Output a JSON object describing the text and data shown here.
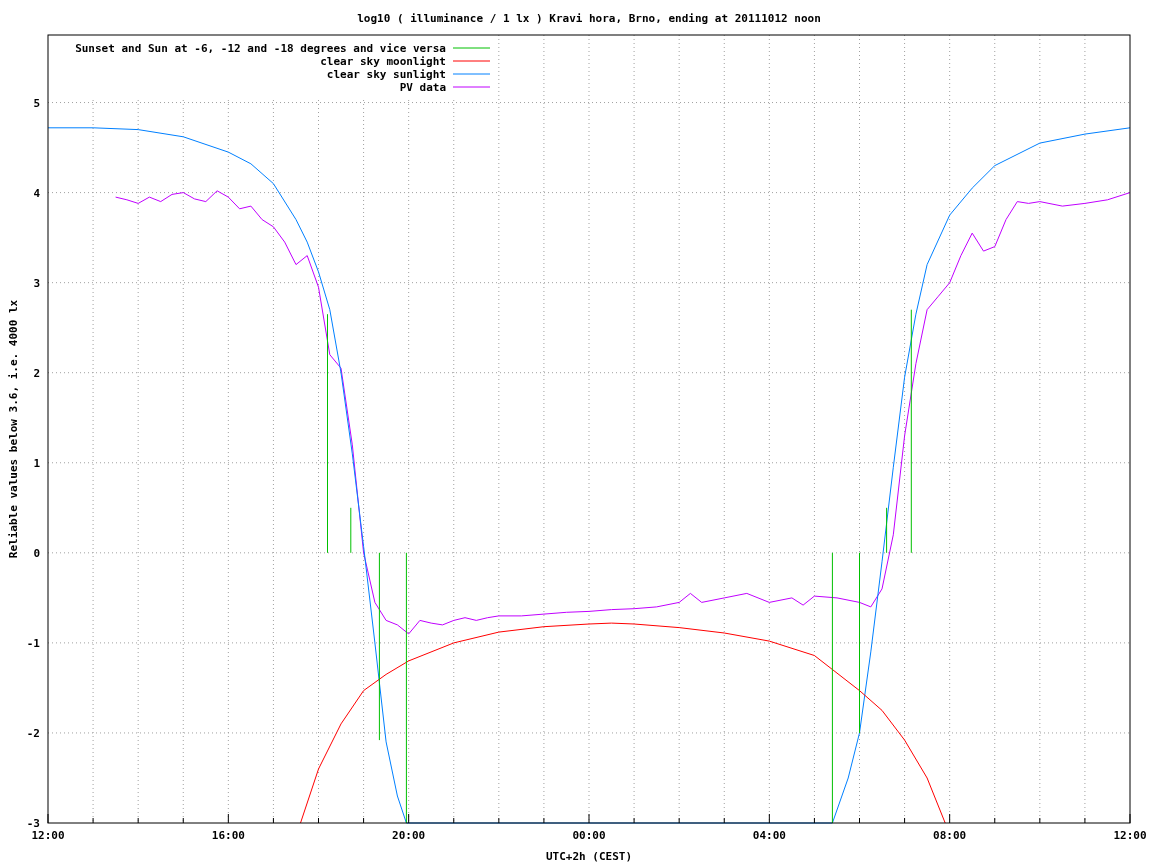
{
  "chart_data": {
    "type": "line",
    "title": "log10 ( illuminance / 1 lx ) Kravi hora, Brno, ending at 20111012 noon",
    "xlabel": "UTC+2h (CEST)",
    "ylabel": "Reliable values below 3.6, i.e. 4000 lx",
    "grid": true,
    "legend": true,
    "xlim": [
      "2011-10-11T12:00",
      "2011-10-12T12:00"
    ],
    "ylim": [
      -3,
      5.75
    ],
    "xticks": [
      {
        "value": "2011-10-11T12:00",
        "label": "12:00"
      },
      {
        "value": "2011-10-11T16:00",
        "label": "16:00"
      },
      {
        "value": "2011-10-11T20:00",
        "label": "20:00"
      },
      {
        "value": "2011-10-12T00:00",
        "label": "00:00"
      },
      {
        "value": "2011-10-12T04:00",
        "label": "04:00"
      },
      {
        "value": "2011-10-12T08:00",
        "label": "08:00"
      },
      {
        "value": "2011-10-12T12:00",
        "label": "12:00"
      }
    ],
    "yticks": [
      -3,
      -2,
      -1,
      0,
      1,
      2,
      3,
      4,
      5
    ],
    "series": [
      {
        "name": "Sunset and Sun at -6, -12 and -18 degrees and vice versa",
        "color": "#00c000",
        "x": [
          "2011-10-11T18:12",
          "2011-10-11T18:12",
          null,
          "2011-10-11T18:43",
          "2011-10-11T18:43",
          null,
          "2011-10-11T19:21",
          "2011-10-11T19:21",
          null,
          "2011-10-11T19:57",
          "2011-10-11T19:57",
          null,
          "2011-10-12T05:24",
          "2011-10-12T05:24",
          null,
          "2011-10-12T06:00",
          "2011-10-12T06:00",
          null,
          "2011-10-12T06:36",
          "2011-10-12T06:36",
          null,
          "2011-10-12T07:09",
          "2011-10-12T07:09"
        ],
        "values": [
          0,
          2.65,
          null,
          0,
          0.5,
          null,
          0,
          -2.08,
          null,
          0,
          -3,
          null,
          0,
          -3,
          null,
          0,
          -2.0,
          null,
          0,
          0.5,
          null,
          0,
          2.7
        ]
      },
      {
        "name": "clear sky moonlight",
        "color": "#ff0000",
        "x": [
          "2011-10-11T17:36",
          "2011-10-11T18:00",
          "2011-10-11T18:30",
          "2011-10-11T19:00",
          "2011-10-11T19:30",
          "2011-10-11T20:00",
          "2011-10-11T21:00",
          "2011-10-11T22:00",
          "2011-10-11T23:00",
          "2011-10-12T00:00",
          "2011-10-12T00:30",
          "2011-10-12T01:00",
          "2011-10-12T02:00",
          "2011-10-12T03:00",
          "2011-10-12T04:00",
          "2011-10-12T05:00",
          "2011-10-12T06:00",
          "2011-10-12T06:30",
          "2011-10-12T07:00",
          "2011-10-12T07:30",
          "2011-10-12T07:54"
        ],
        "values": [
          -3,
          -2.4,
          -1.9,
          -1.53,
          -1.35,
          -1.2,
          -1.0,
          -0.88,
          -0.82,
          -0.79,
          -0.78,
          -0.79,
          -0.83,
          -0.89,
          -0.98,
          -1.14,
          -1.53,
          -1.75,
          -2.08,
          -2.5,
          -3
        ]
      },
      {
        "name": "clear sky sunlight",
        "color": "#0080ff",
        "x": [
          "2011-10-11T12:00",
          "2011-10-11T13:00",
          "2011-10-11T14:00",
          "2011-10-11T15:00",
          "2011-10-11T16:00",
          "2011-10-11T16:30",
          "2011-10-11T17:00",
          "2011-10-11T17:30",
          "2011-10-11T17:45",
          "2011-10-11T18:00",
          "2011-10-11T18:15",
          "2011-10-11T18:30",
          "2011-10-11T18:45",
          "2011-10-11T19:00",
          "2011-10-11T19:15",
          "2011-10-11T19:30",
          "2011-10-11T19:45",
          "2011-10-11T19:57",
          "2011-10-12T05:24",
          "2011-10-12T05:45",
          "2011-10-12T06:00",
          "2011-10-12T06:15",
          "2011-10-12T06:30",
          "2011-10-12T06:45",
          "2011-10-12T07:00",
          "2011-10-12T07:15",
          "2011-10-12T07:30",
          "2011-10-12T08:00",
          "2011-10-12T08:30",
          "2011-10-12T09:00",
          "2011-10-12T10:00",
          "2011-10-12T11:00",
          "2011-10-12T12:00"
        ],
        "values": [
          4.72,
          4.72,
          4.7,
          4.62,
          4.45,
          4.32,
          4.1,
          3.7,
          3.45,
          3.12,
          2.7,
          2.0,
          1.1,
          0.07,
          -1.0,
          -2.1,
          -2.7,
          -3,
          -3,
          -2.5,
          -2.0,
          -1.1,
          -0.1,
          0.95,
          1.95,
          2.65,
          3.2,
          3.75,
          4.05,
          4.3,
          4.55,
          4.65,
          4.72
        ]
      },
      {
        "name": "PV data",
        "color": "#c000ff",
        "x": [
          "2011-10-11T13:30",
          "2011-10-11T13:45",
          "2011-10-11T14:00",
          "2011-10-11T14:15",
          "2011-10-11T14:30",
          "2011-10-11T14:45",
          "2011-10-11T15:00",
          "2011-10-11T15:15",
          "2011-10-11T15:30",
          "2011-10-11T15:45",
          "2011-10-11T16:00",
          "2011-10-11T16:15",
          "2011-10-11T16:30",
          "2011-10-11T16:45",
          "2011-10-11T17:00",
          "2011-10-11T17:15",
          "2011-10-11T17:30",
          "2011-10-11T17:45",
          "2011-10-11T18:00",
          "2011-10-11T18:15",
          "2011-10-11T18:30",
          "2011-10-11T18:45",
          "2011-10-11T19:00",
          "2011-10-11T19:15",
          "2011-10-11T19:30",
          "2011-10-11T19:45",
          "2011-10-11T20:00",
          "2011-10-11T20:15",
          "2011-10-11T20:30",
          "2011-10-11T20:45",
          "2011-10-11T21:00",
          "2011-10-11T21:15",
          "2011-10-11T21:30",
          "2011-10-11T21:45",
          "2011-10-11T22:00",
          "2011-10-11T22:30",
          "2011-10-11T23:00",
          "2011-10-11T23:30",
          "2011-10-12T00:00",
          "2011-10-12T00:30",
          "2011-10-12T01:00",
          "2011-10-12T01:30",
          "2011-10-12T02:00",
          "2011-10-12T02:15",
          "2011-10-12T02:30",
          "2011-10-12T03:00",
          "2011-10-12T03:30",
          "2011-10-12T04:00",
          "2011-10-12T04:30",
          "2011-10-12T04:45",
          "2011-10-12T05:00",
          "2011-10-12T05:30",
          "2011-10-12T06:00",
          "2011-10-12T06:15",
          "2011-10-12T06:30",
          "2011-10-12T06:45",
          "2011-10-12T07:00",
          "2011-10-12T07:15",
          "2011-10-12T07:30",
          "2011-10-12T07:45",
          "2011-10-12T08:00",
          "2011-10-12T08:15",
          "2011-10-12T08:30",
          "2011-10-12T08:45",
          "2011-10-12T09:00",
          "2011-10-12T09:15",
          "2011-10-12T09:30",
          "2011-10-12T09:45",
          "2011-10-12T10:00",
          "2011-10-12T10:30",
          "2011-10-12T11:00",
          "2011-10-12T11:30",
          "2011-10-12T12:00"
        ],
        "values": [
          3.95,
          3.92,
          3.88,
          3.95,
          3.9,
          3.98,
          4.0,
          3.93,
          3.9,
          4.02,
          3.95,
          3.82,
          3.85,
          3.7,
          3.62,
          3.45,
          3.2,
          3.3,
          2.95,
          2.2,
          2.05,
          1.2,
          0.0,
          -0.55,
          -0.75,
          -0.8,
          -0.9,
          -0.75,
          -0.78,
          -0.8,
          -0.75,
          -0.72,
          -0.75,
          -0.72,
          -0.7,
          -0.7,
          -0.68,
          -0.66,
          -0.65,
          -0.63,
          -0.62,
          -0.6,
          -0.55,
          -0.45,
          -0.55,
          -0.5,
          -0.45,
          -0.55,
          -0.5,
          -0.58,
          -0.48,
          -0.5,
          -0.55,
          -0.6,
          -0.4,
          0.2,
          1.3,
          2.1,
          2.7,
          2.85,
          3.0,
          3.3,
          3.55,
          3.35,
          3.4,
          3.7,
          3.9,
          3.88,
          3.9,
          3.85,
          3.88,
          3.92,
          4.0
        ]
      }
    ]
  }
}
